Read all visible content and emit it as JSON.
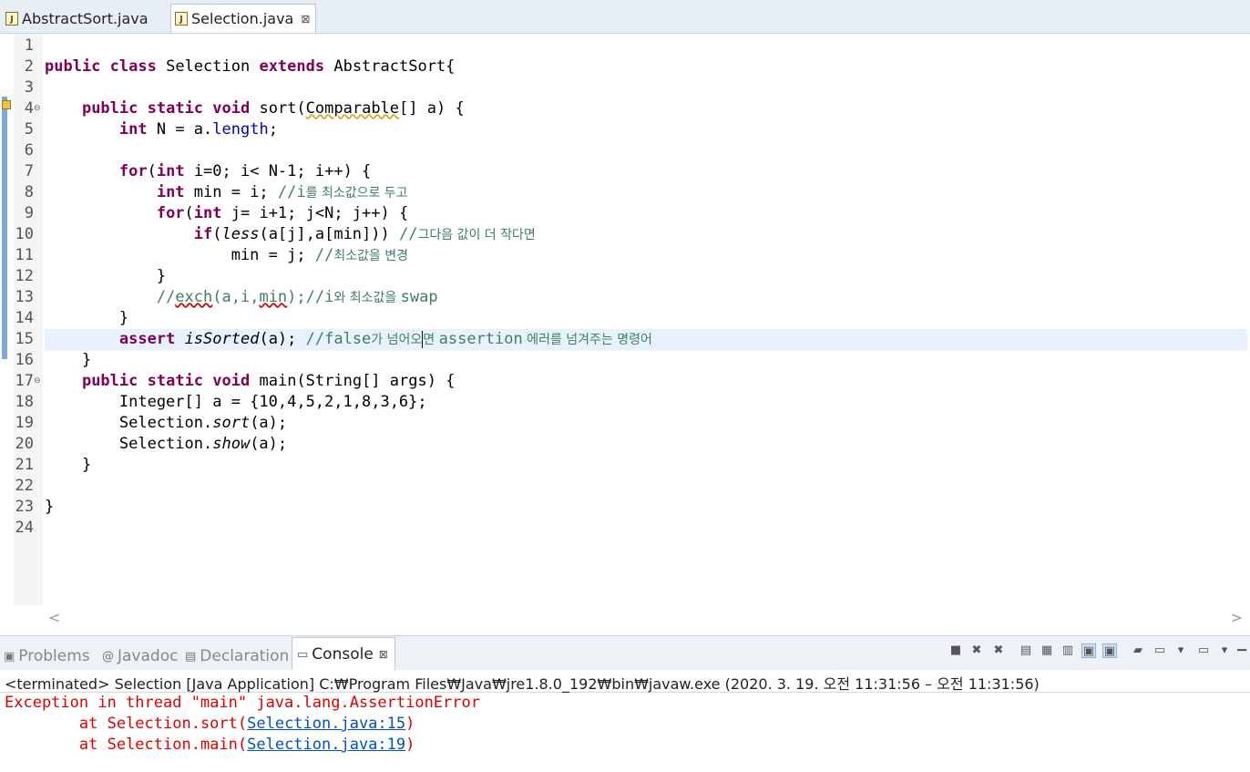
{
  "editor_tabs": [
    {
      "label": "AbstractSort.java",
      "active": false
    },
    {
      "label": "Selection.java",
      "active": true,
      "close": "⊠"
    }
  ],
  "line_numbers": [
    "1",
    "2",
    "3",
    "4",
    "5",
    "6",
    "7",
    "8",
    "9",
    "10",
    "11",
    "12",
    "13",
    "14",
    "15",
    "16",
    "17",
    "18",
    "19",
    "20",
    "21",
    "22",
    "23",
    "24"
  ],
  "code": {
    "l2": {
      "kw1": "public",
      "kw2": "class",
      "name": " Selection ",
      "kw3": "extends",
      "rest": " AbstractSort{"
    },
    "l4": {
      "indent": "    ",
      "kw1": "public",
      "kw2": "static",
      "kw3": "void",
      "m": " sort(",
      "type": "Comparable",
      "rest": "[] a) {"
    },
    "l5": {
      "indent": "        ",
      "kw": "int",
      "a": " N = a.",
      "fld": "length",
      "b": ";"
    },
    "l7": {
      "indent": "        ",
      "kw1": "for",
      "a": "(",
      "kw2": "int",
      "b": " i=0; i< N-1; i++) {"
    },
    "l8": {
      "indent": "            ",
      "kw": "int",
      "a": " min = i; ",
      "cm": "//i",
      "ko": "를 최소값으로 두고"
    },
    "l9": {
      "indent": "            ",
      "kw1": "for",
      "a": "(",
      "kw2": "int",
      "b": " j= i+1; j<N; j++) {"
    },
    "l10": {
      "indent": "                ",
      "kw": "if",
      "a": "(",
      "it": "less",
      "b": "(a[j],a[min])) ",
      "cm": "//",
      "ko": "그다음 값이 더 작다면"
    },
    "l11": {
      "indent": "                    ",
      "a": "min = j; ",
      "cm": "//",
      "ko": "최소값을 변경"
    },
    "l12": {
      "text": "            }"
    },
    "l13": {
      "indent": "            ",
      "cm1": "//",
      "sq1": "exch",
      "cm2": "(a,i,",
      "sq2": "min",
      "cm3": ");//i",
      "ko": "와 최소값을 ",
      "cm4": "swap"
    },
    "l14": {
      "text": "        }"
    },
    "l15": {
      "indent": "        ",
      "kw": "assert",
      "sp": " ",
      "it": "isSorted",
      "a": "(a); ",
      "cm1": "//false",
      "ko1": "가 넘어오",
      "ko2": "면 ",
      "cm2": "assertion",
      "ko3": " 에러를 넘겨주는 명령어"
    },
    "l16": {
      "text": "    }"
    },
    "l17": {
      "indent": "    ",
      "kw1": "public",
      "kw2": "static",
      "kw3": "void",
      "rest": " main(String[] args) {"
    },
    "l18": {
      "text": "        Integer[] a = {10,4,5,2,1,8,3,6};"
    },
    "l19": {
      "a": "        Selection.",
      "it": "sort",
      "b": "(a);"
    },
    "l20": {
      "a": "        Selection.",
      "it": "show",
      "b": "(a);"
    },
    "l21": {
      "text": "    }"
    },
    "l23": {
      "text": "}"
    }
  },
  "view_tabs": [
    {
      "label": "Problems",
      "icon": "problems-icon"
    },
    {
      "label": "Javadoc",
      "icon": "javadoc-icon"
    },
    {
      "label": "Declaration",
      "icon": "declaration-icon"
    },
    {
      "label": "Console",
      "icon": "console-icon",
      "active": true,
      "close": "⊠"
    }
  ],
  "console": {
    "header": "<terminated> Selection [Java Application] C:₩Program Files₩Java₩jre1.8.0_192₩bin₩javaw.exe  (2020. 3. 19. 오전 11:31:56 – 오전 11:31:56)",
    "line1": "Exception in thread \"main\" java.lang.AssertionError",
    "line2_prefix": "\tat Selection.sort(",
    "line2_link": "Selection.java:15",
    "line2_suffix": ")",
    "line3_prefix": "\tat Selection.main(",
    "line3_link": "Selection.java:19",
    "line3_suffix": ")"
  },
  "colors": {
    "keyword": "#7f0055",
    "comment": "#3f7f5f",
    "field": "#0000c0",
    "error": "#e00000",
    "link": "#0050c8"
  }
}
